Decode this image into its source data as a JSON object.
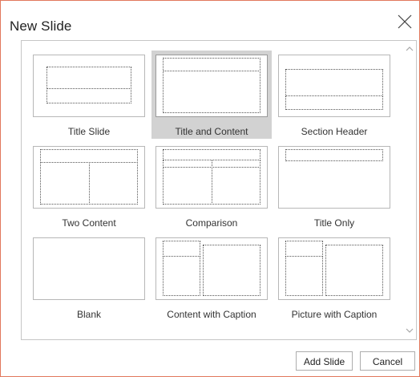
{
  "dialog": {
    "title": "New Slide",
    "close_icon": "close-icon"
  },
  "layouts": [
    {
      "label": "Title Slide",
      "selected": false
    },
    {
      "label": "Title and Content",
      "selected": true
    },
    {
      "label": "Section Header",
      "selected": false
    },
    {
      "label": "Two Content",
      "selected": false
    },
    {
      "label": "Comparison",
      "selected": false
    },
    {
      "label": "Title Only",
      "selected": false
    },
    {
      "label": "Blank",
      "selected": false
    },
    {
      "label": "Content with Caption",
      "selected": false
    },
    {
      "label": "Picture with Caption",
      "selected": false
    }
  ],
  "buttons": {
    "add": "Add Slide",
    "cancel": "Cancel"
  },
  "colors": {
    "border_accent": "#e2785d",
    "selected_bg": "#d2d2d2"
  }
}
